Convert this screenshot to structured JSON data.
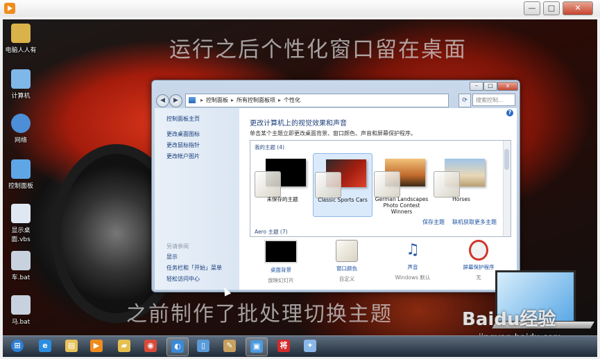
{
  "desktop_icons": [
    {
      "label": "电脑人人有",
      "icon": "user-folder-icon",
      "color": "#d9b24a"
    },
    {
      "label": "计算机",
      "icon": "computer-icon",
      "color": "#7fb7e8"
    },
    {
      "label": "网络",
      "icon": "network-icon",
      "color": "#4c8fd6"
    },
    {
      "label": "控制面板",
      "icon": "control-panel-icon",
      "color": "#5ea6e6"
    },
    {
      "label": "显示桌面.vbs",
      "icon": "script-file-icon",
      "color": "#dfe8f2"
    },
    {
      "label": "车.bat",
      "icon": "batch-file-icon",
      "color": "#c8d2de"
    },
    {
      "label": "马.bat",
      "icon": "batch-file-icon",
      "color": "#c8d2de"
    }
  ],
  "overlay": {
    "top_text": "运行之后个性化窗口留在桌面",
    "bottom_text": "之前制作了批处理切换主题"
  },
  "window": {
    "breadcrumb": [
      "控制面板",
      "所有控制面板项",
      "个性化"
    ],
    "search_placeholder": "搜索控制...",
    "sidebar": {
      "home_link": "控制面板主页",
      "links": [
        "更改桌面图标",
        "更改鼠标指针",
        "更改帐户图片"
      ],
      "see_also_label": "另请参阅",
      "see_also": [
        "显示",
        "任务栏和「开始」菜单",
        "轻松访问中心"
      ]
    },
    "main_title": "更改计算机上的视觉效果和声音",
    "description": "单击某个主题立即更改桌面背景、窗口颜色、声音和屏幕保护程序。",
    "my_themes_label": "我的主题 (4)",
    "themes": [
      {
        "name": "未保存的主题",
        "selected": false
      },
      {
        "name": "Classic Sports Cars",
        "selected": true
      },
      {
        "name": "German Landscapes Photo Contest Winners",
        "selected": false
      },
      {
        "name": "Horses",
        "selected": false
      }
    ],
    "save_theme": "保存主题",
    "get_more_themes": "联机获取更多主题",
    "aero_label": "Aero 主题 (7)",
    "bottom_items": [
      {
        "label": "桌面背景",
        "sub": "放映幻灯片",
        "icon": "desktop-background-icon"
      },
      {
        "label": "窗口颜色",
        "sub": "自定义",
        "icon": "window-color-icon"
      },
      {
        "label": "声音",
        "sub": "Windows 默认",
        "icon": "sound-icon"
      },
      {
        "label": "屏幕保护程序",
        "sub": "无",
        "icon": "screensaver-icon"
      }
    ]
  },
  "taskbar": [
    {
      "icon": "start-orb-icon",
      "glyph": "⊞",
      "color": "#2d7fd6",
      "active": false
    },
    {
      "icon": "ie-icon",
      "glyph": "e",
      "color": "#2b8ee0",
      "active": false
    },
    {
      "icon": "explorer-icon",
      "glyph": "▤",
      "color": "#e8c25a",
      "active": false
    },
    {
      "icon": "media-player-icon",
      "glyph": "▶",
      "color": "#f08c1c",
      "active": false
    },
    {
      "icon": "folder-icon",
      "glyph": "▰",
      "color": "#e6c04e",
      "active": false
    },
    {
      "icon": "chrome-icon",
      "glyph": "◉",
      "color": "#d94a3a",
      "active": false
    },
    {
      "icon": "browser-icon",
      "glyph": "◐",
      "color": "#3a8ad8",
      "active": true
    },
    {
      "icon": "document-icon",
      "glyph": "▯",
      "color": "#5a9ad8",
      "active": false
    },
    {
      "icon": "paint-icon",
      "glyph": "✎",
      "color": "#c8a060",
      "active": false
    },
    {
      "icon": "control-panel-icon",
      "glyph": "▣",
      "color": "#4c9ae0",
      "active": true
    },
    {
      "icon": "app-jiang-icon",
      "glyph": "将",
      "color": "#d42a2a",
      "active": false
    },
    {
      "icon": "app-bird-icon",
      "glyph": "✦",
      "color": "#8ab8e8",
      "active": false
    }
  ],
  "watermark": {
    "brand": "Baidu经验",
    "url": "jingyan.baidu.com"
  }
}
